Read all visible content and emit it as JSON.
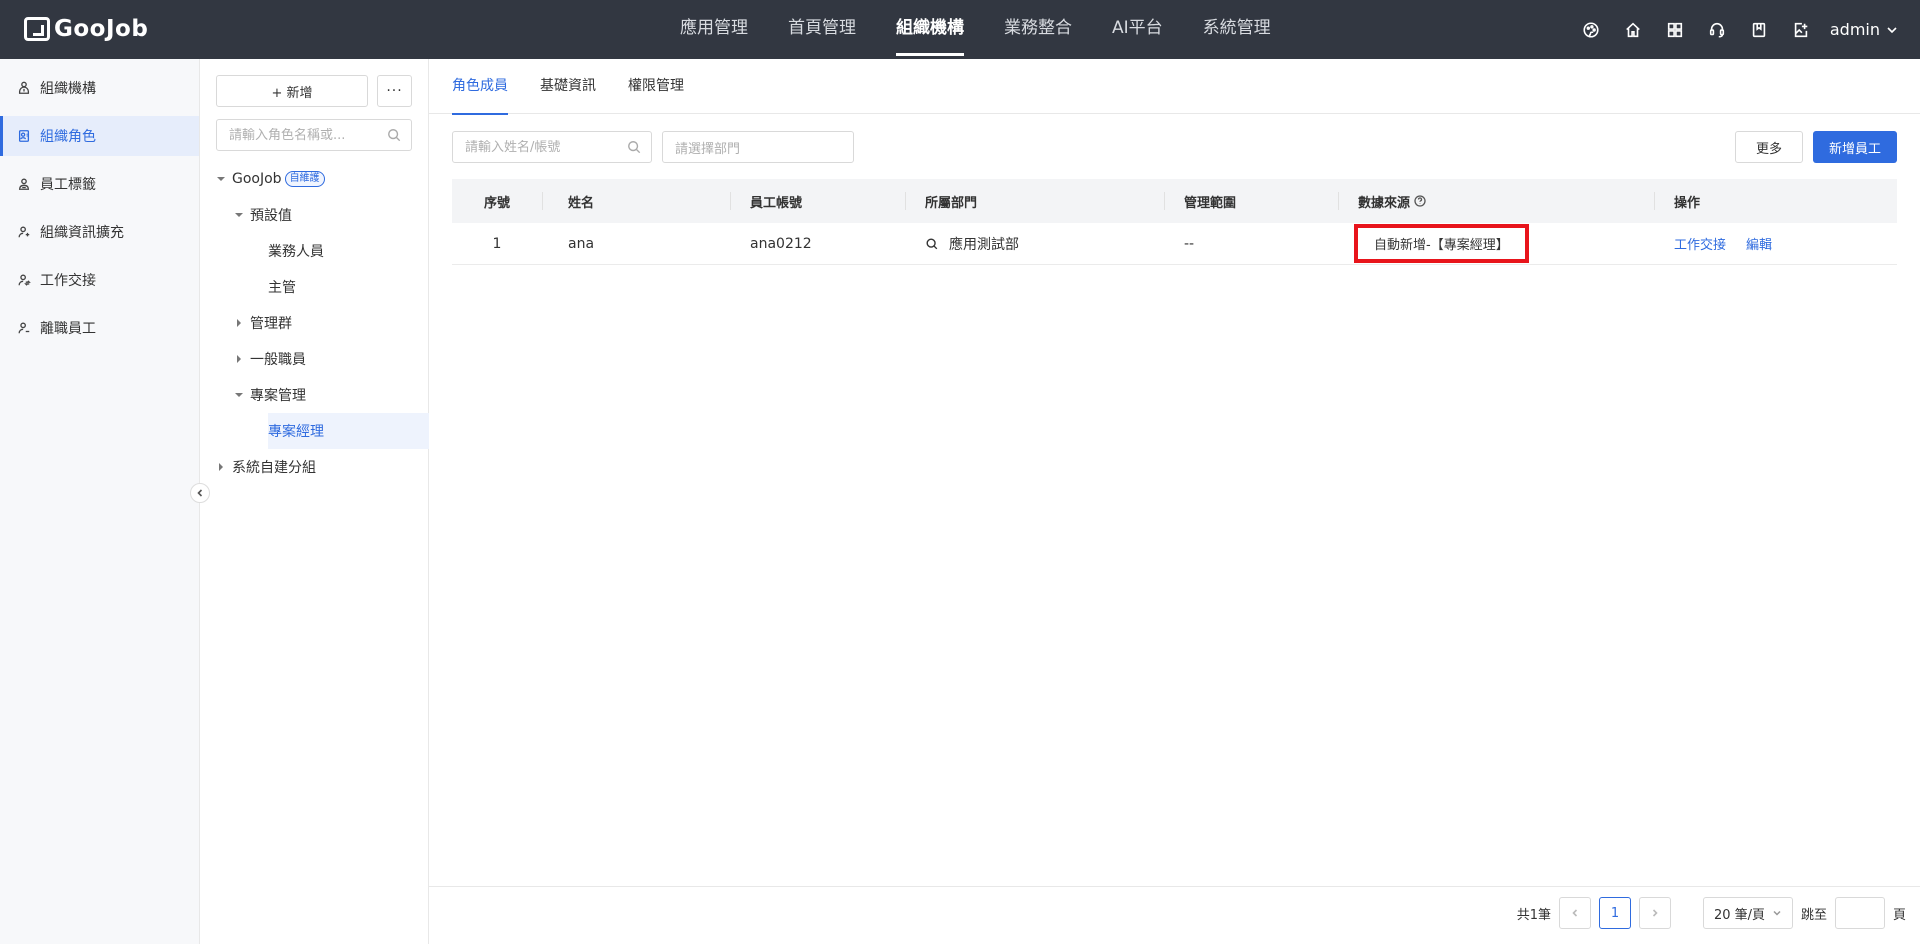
{
  "header": {
    "logo_text": "GooJob",
    "nav": [
      "應用管理",
      "首頁管理",
      "組織機構",
      "業務整合",
      "AI平台",
      "系統管理"
    ],
    "nav_active": 2,
    "user": "admin"
  },
  "sidebar": {
    "items": [
      {
        "label": "組織機構",
        "icon": "org-icon"
      },
      {
        "label": "組織角色",
        "icon": "role-icon",
        "active": true
      },
      {
        "label": "員工標籤",
        "icon": "tag-icon"
      },
      {
        "label": "組織資訊擴充",
        "icon": "user-extend-icon"
      },
      {
        "label": "工作交接",
        "icon": "handover-icon"
      },
      {
        "label": "離職員工",
        "icon": "resigned-icon"
      }
    ]
  },
  "tree_panel": {
    "add_label": "+ 新增",
    "more_label": "···",
    "search_placeholder": "請輸入角色名稱或...",
    "nodes": {
      "root": "GooJob",
      "root_tag": "自維護",
      "preset": "預設值",
      "business_staff": "業務人員",
      "supervisor": "主管",
      "admin_group": "管理群",
      "general_staff": "一般職員",
      "project_mgmt": "專案管理",
      "project_manager": "專案經理",
      "system_group": "系統自建分組"
    }
  },
  "main": {
    "tabs": [
      "角色成員",
      "基礎資訊",
      "權限管理"
    ],
    "active_tab": 0,
    "filter_name_placeholder": "請輸入姓名/帳號",
    "filter_dept_placeholder": "請選擇部門",
    "more_button": "更多",
    "add_button": "新增員工",
    "table": {
      "columns": [
        "序號",
        "姓名",
        "員工帳號",
        "所屬部門",
        "管理範圍",
        "數據來源",
        "操作"
      ],
      "rows": [
        {
          "index": "1",
          "name": "ana",
          "account": "ana0212",
          "department": "應用測試部",
          "scope": "--",
          "source": "自動新增-【專案經理】",
          "actions": [
            "工作交接",
            "編輯"
          ]
        }
      ]
    },
    "pagination": {
      "total": "共1筆",
      "current_page": "1",
      "page_size": "20 筆/頁",
      "jump_label": "跳至",
      "page_suffix": "頁"
    }
  },
  "colors": {
    "topbar": "#323741",
    "primary": "#2f6bdf",
    "highlight": "#e8141b"
  }
}
